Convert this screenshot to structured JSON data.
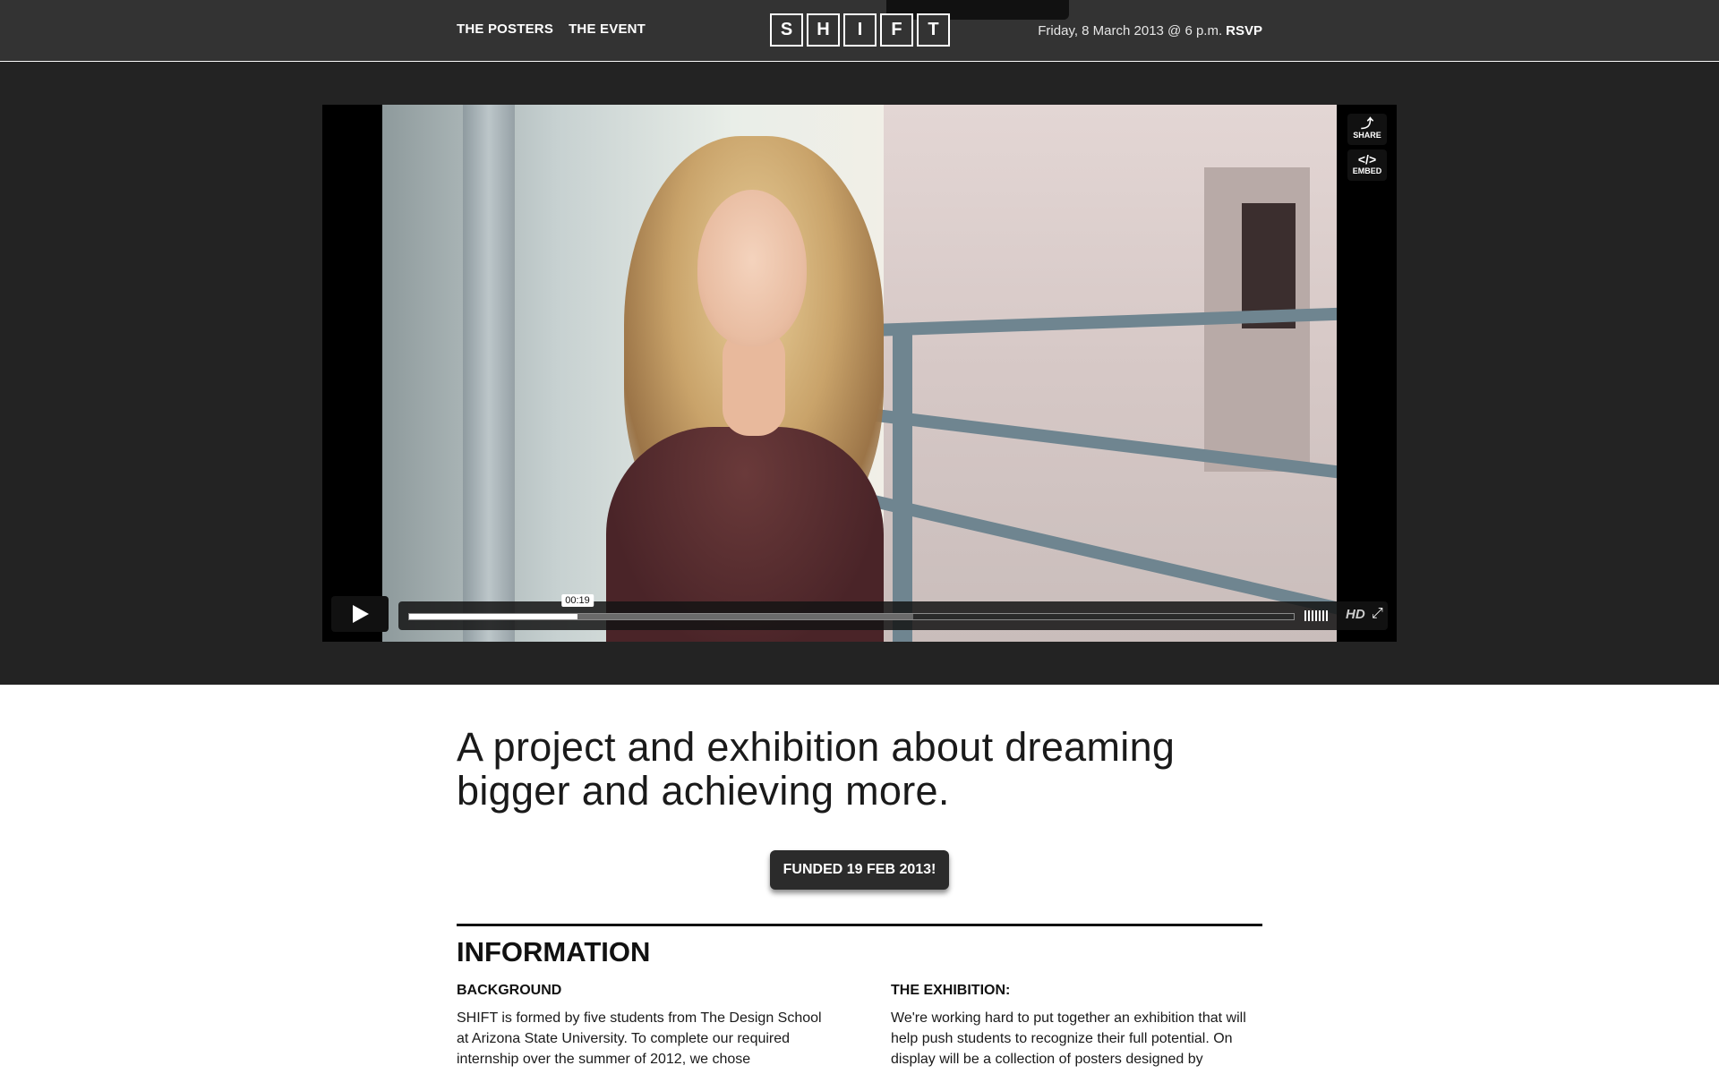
{
  "nav": {
    "links": [
      "THE POSTERS",
      "THE EVENT"
    ],
    "logo_letters": [
      "S",
      "H",
      "I",
      "F",
      "T"
    ],
    "event_date": "Friday, 8 March 2013 @ 6 p.m.",
    "rsvp_label": "RSVP"
  },
  "video": {
    "share_label": "SHARE",
    "embed_label": "EMBED",
    "current_time": "00:19",
    "progress_played_fraction": 0.19,
    "progress_loaded_fraction": 0.57,
    "hd_label": "HD",
    "icons": [
      "play-icon",
      "share-icon",
      "embed-icon",
      "volume-icon",
      "fullscreen-icon"
    ]
  },
  "main": {
    "headline": "A project and exhibition about dreaming bigger and achieving more.",
    "funded_button": "FUNDED 19 FEB 2013!",
    "section_title": "INFORMATION",
    "background": {
      "heading": "BACKGROUND",
      "text": "SHIFT is formed by five students from The Design School at Arizona State University. To complete our required internship over the summer of 2012, we chose"
    },
    "exhibition": {
      "heading": "THE EXHIBITION:",
      "text": "We're working hard to put together an exhibition that will help push students to recognize their full potential. On display will be a collection of posters designed by"
    }
  },
  "colors": {
    "topbar": "#333333",
    "video_band": "#232323",
    "button_dark": "#2b2b2b",
    "text": "#1a1a1a"
  }
}
